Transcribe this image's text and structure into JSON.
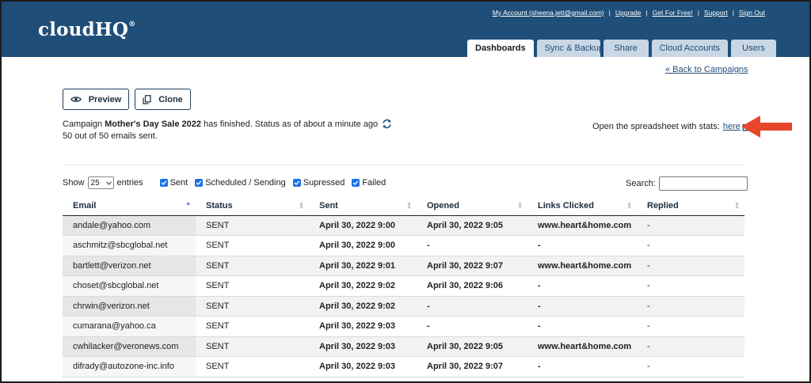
{
  "header": {
    "logo": "cloudHQ",
    "logo_mark": "®",
    "top_links": [
      "My Account (sheena.jett@gmail.com)",
      "Upgrade",
      "Get For Free!",
      "Support",
      "Sign Out"
    ],
    "tabs": [
      {
        "label": "Dashboards",
        "active": true
      },
      {
        "label": "Sync & Backup",
        "active": false
      },
      {
        "label": "Share",
        "active": false
      },
      {
        "label": "Cloud Accounts",
        "active": false
      },
      {
        "label": "Users",
        "active": false
      }
    ],
    "brand_color": "#1f4e79"
  },
  "nav": {
    "back_link": "« Back to Campaigns"
  },
  "actions": {
    "preview_label": "Preview",
    "clone_label": "Clone"
  },
  "campaign": {
    "prefix": "Campaign",
    "name": "Mother's Day Sale 2022",
    "status_text": "has finished. Status as of about a minute ago",
    "sent_summary": "50 out of 50 emails sent."
  },
  "spreadsheet": {
    "label": "Open the spreadsheet with stats:",
    "link_text": "here",
    "suffix": ".",
    "arrow_color": "#e8462a"
  },
  "filters": {
    "show_label": "Show",
    "entries_value": "25",
    "entries_label": "entries",
    "checkboxes": [
      "Sent",
      "Scheduled / Sending",
      "Supressed",
      "Failed"
    ],
    "search_label": "Search:",
    "search_value": ""
  },
  "table": {
    "columns": [
      "Email",
      "Status",
      "Sent",
      "Opened",
      "Links Clicked",
      "Replied"
    ],
    "rows": [
      [
        "andale@yahoo.com",
        "SENT",
        "April 30, 2022 9:00",
        "April 30, 2022 9:05",
        "www.heart&home.com",
        "-"
      ],
      [
        "aschmitz@sbcglobal.net",
        "SENT",
        "April 30, 2022 9:00",
        "-",
        "-",
        "-"
      ],
      [
        "bartlett@verizon.net",
        "SENT",
        "April 30, 2022 9:01",
        "April 30, 2022 9:07",
        "www.heart&home.com",
        "-"
      ],
      [
        "choset@sbcglobal.net",
        "SENT",
        "April 30, 2022 9:02",
        "April 30, 2022 9:06",
        "-",
        "-"
      ],
      [
        "chrwin@verizon.net",
        "SENT",
        "April 30, 2022 9:02",
        "-",
        "-",
        "-"
      ],
      [
        "cumarana@yahoo.ca",
        "SENT",
        "April 30, 2022 9:03",
        "-",
        "-",
        "-"
      ],
      [
        "cwhilacker@veronews.com",
        "SENT",
        "April 30, 2022 9:03",
        "April 30, 2022 9:05",
        "www.heart&home.com",
        "-"
      ],
      [
        "difrady@autozone-inc.info",
        "SENT",
        "April 30, 2022 9:03",
        "April 30, 2022 9:07",
        "-",
        "-"
      ]
    ]
  }
}
